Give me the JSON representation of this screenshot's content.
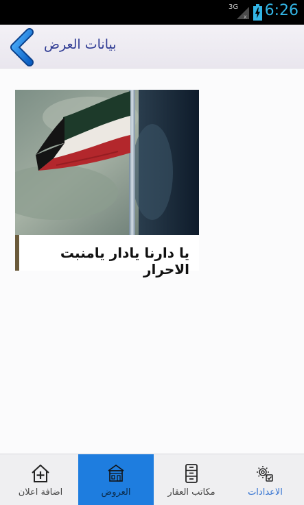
{
  "status_bar": {
    "network": "3G",
    "time": "6:26",
    "time_color": "#33b5e5"
  },
  "header": {
    "title": "بيانات العرض",
    "back_icon": "chevron-left-icon",
    "title_color": "#2e3a93"
  },
  "listing": {
    "caption": "يا دارنا يادار يامنبت الاحرار",
    "image": "kuwait-flag-photo"
  },
  "bottom_nav": {
    "active_color": "#1e7ddf",
    "items": [
      {
        "label": "اضافة اعلان",
        "icon": "add-home-icon",
        "active": false
      },
      {
        "label": "العروض",
        "icon": "offers-house-icon",
        "active": true
      },
      {
        "label": "مكاتب العقار",
        "icon": "file-cabinet-icon",
        "active": false
      },
      {
        "label": "الاعدادات",
        "icon": "settings-gear-icon",
        "active": false
      }
    ]
  }
}
